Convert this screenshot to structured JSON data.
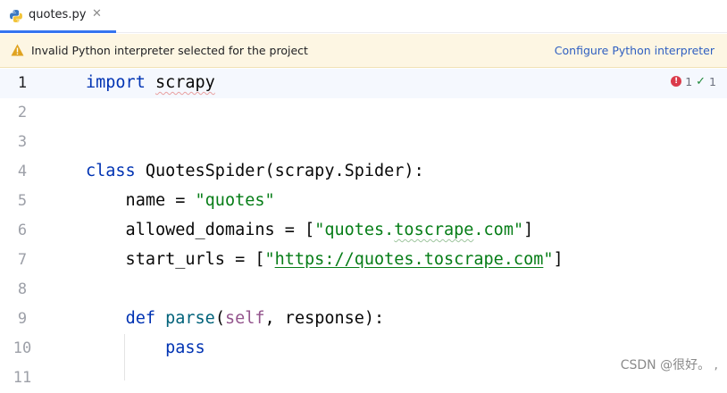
{
  "tab": {
    "filename": "quotes.py",
    "close": "✕"
  },
  "banner": {
    "message": "Invalid Python interpreter selected for the project",
    "action": "Configure Python interpreter"
  },
  "inspection": {
    "errors": "1",
    "checks": "1"
  },
  "editor": {
    "lines": [
      {
        "n": "1"
      },
      {
        "n": "2"
      },
      {
        "n": "3"
      },
      {
        "n": "4"
      },
      {
        "n": "5"
      },
      {
        "n": "6"
      },
      {
        "n": "7"
      },
      {
        "n": "8"
      },
      {
        "n": "9"
      },
      {
        "n": "10"
      },
      {
        "n": "11"
      }
    ],
    "tokens": {
      "l1_kw": "import",
      "l1_mod": "scrapy",
      "l4_kw": "class",
      "l4_rest": " QuotesSpider(scrapy.Spider):",
      "l5_a": "    name = ",
      "l5_str": "\"quotes\"",
      "l6_a": "    allowed_domains = [",
      "l6_q1": "\"",
      "l6_s1": "quotes.",
      "l6_s2": "toscrape",
      "l6_s3": ".com",
      "l6_q2": "\"",
      "l6_b": "]",
      "l7_a": "    start_urls = [",
      "l7_q1": "\"",
      "l7_url": "https://quotes.toscrape.com",
      "l7_q2": "\"",
      "l7_b": "]",
      "l9_sp": "    ",
      "l9_kw": "def",
      "l9_sp2": " ",
      "l9_fn": "parse",
      "l9_p1": "(",
      "l9_self": "self",
      "l9_rest": ", response):",
      "l10_sp": "        ",
      "l10_kw": "pass"
    }
  },
  "watermark": "CSDN @很好。 ,"
}
